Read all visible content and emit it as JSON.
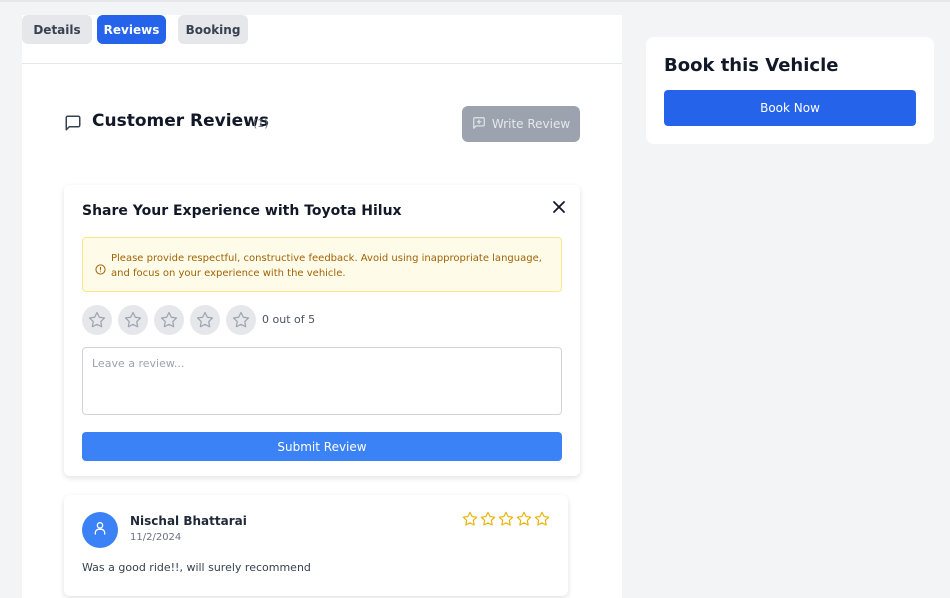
{
  "tabs": [
    {
      "label": "Details",
      "active": false
    },
    {
      "label": "Reviews",
      "active": true
    },
    {
      "label": "Booking",
      "active": false
    }
  ],
  "reviews": {
    "title": "Customer Reviews",
    "count": "(1)",
    "write_button": "Write Review",
    "icon": "message-square-icon"
  },
  "form": {
    "title": "Share Your Experience with Toyota Hilux",
    "notice": "Please provide respectful, constructive feedback. Avoid using inappropriate language, and focus on your experience with the vehicle.",
    "rating_text": "0 out of 5",
    "rating_value": 0,
    "rating_max": 5,
    "placeholder": "Leave a review...",
    "value": "",
    "submit_label": "Submit Review"
  },
  "review_list": [
    {
      "name": "Nischal Bhattarai",
      "date": "11/2/2024",
      "rating": 0,
      "rating_max": 5,
      "text": "Was a good ride!!, will surely recommend"
    }
  ],
  "sidebar": {
    "title": "Book this Vehicle",
    "button": "Book Now"
  },
  "colors": {
    "primary": "#2563eb",
    "submit": "#3b82f6",
    "star_outline": "#facc15",
    "notice_bg": "#fefce8",
    "notice_text": "#a16207"
  }
}
